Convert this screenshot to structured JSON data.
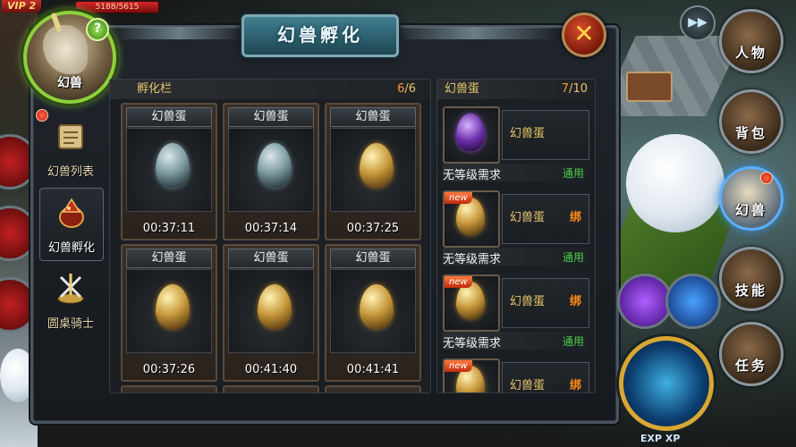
{
  "status": {
    "vip": "VIP 2",
    "hp": "5188/5615"
  },
  "portrait": {
    "label": "幻兽",
    "help": "?"
  },
  "window": {
    "title": "幻兽孵化",
    "close": "✕"
  },
  "tabs": [
    {
      "label": "幻兽列表",
      "icon": "scroll-icon"
    },
    {
      "label": "幻兽孵化",
      "icon": "dragon-egg-icon"
    },
    {
      "label": "圆桌骑士",
      "icon": "crossed-swords-icon"
    }
  ],
  "hatch": {
    "title": "孵化栏",
    "count_current": "6",
    "count_total": "/6",
    "slots": [
      {
        "name": "幻兽蛋",
        "egg": "silver",
        "timer": "00:37:11"
      },
      {
        "name": "幻兽蛋",
        "egg": "silver",
        "timer": "00:37:14"
      },
      {
        "name": "幻兽蛋",
        "egg": "gold",
        "timer": "00:37:25"
      },
      {
        "name": "幻兽蛋",
        "egg": "gold",
        "timer": "00:37:26"
      },
      {
        "name": "幻兽蛋",
        "egg": "gold",
        "timer": "00:41:40"
      },
      {
        "name": "幻兽蛋",
        "egg": "gold",
        "timer": "00:41:41"
      }
    ]
  },
  "egg_list": {
    "title": "幻兽蛋",
    "count_current": "7",
    "count_total": "/10",
    "items": [
      {
        "name": "幻兽蛋",
        "bind": "",
        "new": "",
        "egg": "purple",
        "req": "无等级需求",
        "use": "通用"
      },
      {
        "name": "幻兽蛋",
        "bind": "绑",
        "new": "new",
        "egg": "gold",
        "req": "无等级需求",
        "use": "通用"
      },
      {
        "name": "幻兽蛋",
        "bind": "绑",
        "new": "new",
        "egg": "gold",
        "req": "无等级需求",
        "use": "通用"
      },
      {
        "name": "幻兽蛋",
        "bind": "绑",
        "new": "new",
        "egg": "gold",
        "req": "",
        "use": ""
      }
    ]
  },
  "right_menu": [
    {
      "label": "人物",
      "icon": "character-icon"
    },
    {
      "label": "背包",
      "icon": "backpack-icon"
    },
    {
      "label": "幻兽",
      "icon": "unicorn-icon"
    },
    {
      "label": "技能",
      "icon": "skill-book-icon"
    },
    {
      "label": "任务",
      "icon": "quest-icon"
    }
  ],
  "fast_forward": "▶▶",
  "exp_label": "EXP XP",
  "colors": {
    "accent_gold": "#e8c56a",
    "green_ok": "#4ad04a",
    "bind_orange": "#ff8a1a",
    "title_teal": "#3f7f90"
  }
}
